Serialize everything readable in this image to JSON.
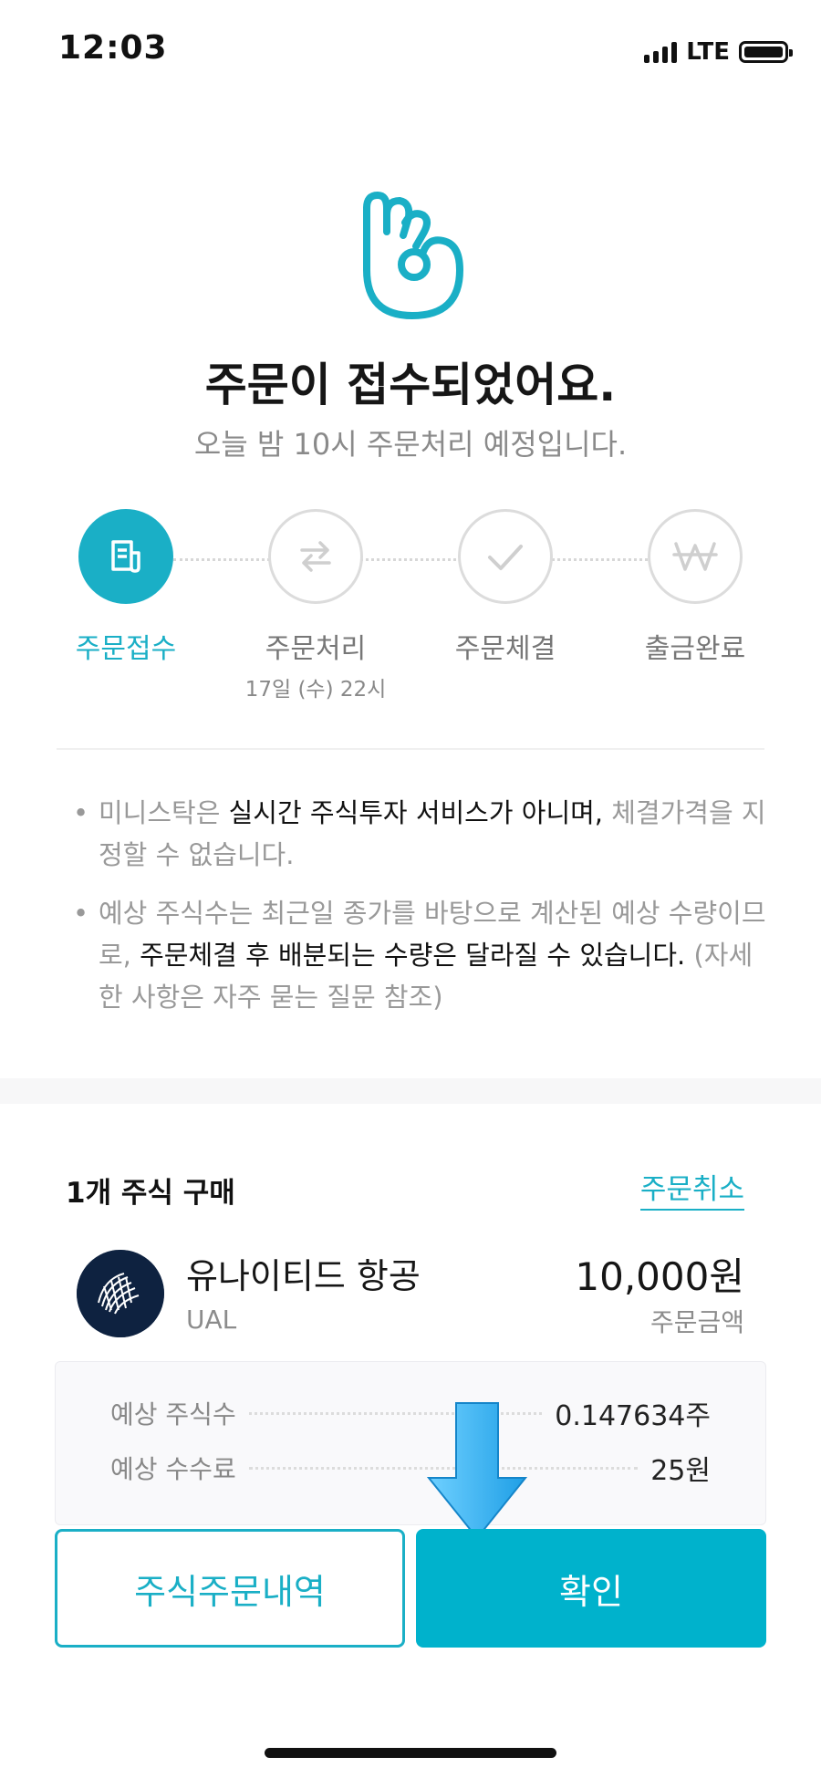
{
  "status": {
    "time": "12:03",
    "network": "LTE"
  },
  "hero": {
    "title": "주문이 접수되었어요.",
    "subtitle": "오늘 밤 10시 주문처리 예정입니다."
  },
  "steps": [
    {
      "label": "주문접수",
      "sub": "",
      "active": true,
      "icon": "document-icon"
    },
    {
      "label": "주문처리",
      "sub": "17일 (수) 22시",
      "active": false,
      "icon": "exchange-arrows-icon"
    },
    {
      "label": "주문체결",
      "sub": "",
      "active": false,
      "icon": "check-icon"
    },
    {
      "label": "출금완료",
      "sub": "",
      "active": false,
      "icon": "won-icon"
    }
  ],
  "notices": {
    "n1_a": "미니스탁은 ",
    "n1_b": "실시간 주식투자 서비스가 아니며,",
    "n1_c": " 체결가격을 지정할 수 없습니다.",
    "n2_a": "예상 주식수는 최근일 종가를 바탕으로 계산된 예상 수량이므로,",
    "n2_b": " 주문체결 후 배분되는 수량은 달라질 수 있습니다.",
    "n2_c": " (자세한 사항은 자주 묻는 질문 참조)"
  },
  "order": {
    "heading": "1개 주식 구매",
    "cancel": "주문취소",
    "stock_name": "유나이티드 항공",
    "ticker": "UAL",
    "amount": "10,000원",
    "amount_label": "주문금액"
  },
  "estimate": {
    "shares_label": "예상 주식수",
    "shares_value": "0.147634주",
    "fee_label": "예상 수수료",
    "fee_value": "25원"
  },
  "buttons": {
    "history": "주식주문내역",
    "confirm": "확인"
  },
  "colors": {
    "accent": "#1aafc6",
    "primary_button": "#00b2cc",
    "arrow": "#3ab8f5"
  }
}
